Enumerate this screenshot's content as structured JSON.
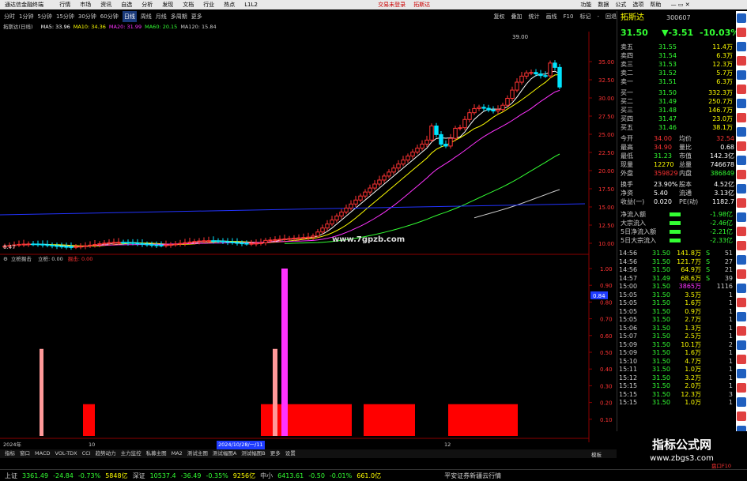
{
  "app": {
    "title": "通达信金融终端",
    "menu": [
      "行情",
      "市场",
      "资讯",
      "自选",
      "分析",
      "发现",
      "文档",
      "行业",
      "热点",
      "L1L2"
    ],
    "center_links": [
      "交易未登录",
      "拓斯达"
    ],
    "right_menu": [
      "功能",
      "数据",
      "公式",
      "选项",
      "帮助"
    ]
  },
  "periods": [
    "分时",
    "1分钟",
    "5分钟",
    "15分钟",
    "30分钟",
    "60分钟",
    "日线",
    "周线",
    "月线",
    "多周期",
    "更多"
  ],
  "selected_period": "日线",
  "toolbar_right": [
    "复权",
    "叠加",
    "统计",
    "画线",
    "F10",
    "标记",
    "-",
    "回退"
  ],
  "stock": {
    "name": "拓斯达",
    "code": "300607",
    "price": "31.50",
    "change": "▼-3.51",
    "pct": "-10.03%"
  },
  "main_legend": {
    "label": "拓斯达(日线)",
    "items": [
      {
        "text": "MA5: 33.96",
        "color": "#ffffff"
      },
      {
        "text": "MA10: 34.36",
        "color": "#ffff00"
      },
      {
        "text": "MA20: 31.99",
        "color": "#ff33ff"
      },
      {
        "text": "MA60: 20.15",
        "color": "#33ff33"
      },
      {
        "text": "MA120: 15.84",
        "color": "#cccccc"
      }
    ]
  },
  "price_labels": [
    "35.00",
    "32.50",
    "30.00",
    "27.50",
    "25.00",
    "22.50",
    "20.00",
    "17.50",
    "15.00",
    "12.50",
    "10.00"
  ],
  "max_label": "39.00",
  "min_label": "8.47",
  "watermark": "www.7gpzb.com",
  "sub_legend": {
    "name": "立桩掘击",
    "items": [
      {
        "text": "立桩: 0.00",
        "color": "#cccccc"
      },
      {
        "text": "掘击: 0.00",
        "color": "#ff3333"
      }
    ]
  },
  "sub_labels": [
    "1.00",
    "0.90",
    "0.80",
    "0.70",
    "0.60",
    "0.50",
    "0.40",
    "0.30",
    "0.20",
    "0.10"
  ],
  "sub_marker": "0.84",
  "date_axis": [
    "2024年",
    "10",
    "2024/10/28/一/11",
    "12"
  ],
  "sell": [
    {
      "label": "卖五",
      "price": "31.55",
      "vol": "11.4万"
    },
    {
      "label": "卖四",
      "price": "31.54",
      "vol": "6.3万"
    },
    {
      "label": "卖三",
      "price": "31.53",
      "vol": "12.3万"
    },
    {
      "label": "卖二",
      "price": "31.52",
      "vol": "5.7万"
    },
    {
      "label": "卖一",
      "price": "31.51",
      "vol": "6.3万"
    }
  ],
  "buy": [
    {
      "label": "买一",
      "price": "31.50",
      "vol": "332.3万"
    },
    {
      "label": "买二",
      "price": "31.49",
      "vol": "250.7万"
    },
    {
      "label": "买三",
      "price": "31.48",
      "vol": "146.7万"
    },
    {
      "label": "买四",
      "price": "31.47",
      "vol": "23.0万"
    },
    {
      "label": "买五",
      "price": "31.46",
      "vol": "38.1万"
    }
  ],
  "stats": [
    {
      "l1": "今开",
      "v1": "34.00",
      "l2": "均价",
      "v2": "32.54",
      "c1": "#ff3333",
      "c2": "#ff3333"
    },
    {
      "l1": "最高",
      "v1": "34.90",
      "l2": "量比",
      "v2": "0.68",
      "c1": "#ff3333",
      "c2": "#ffffff"
    },
    {
      "l1": "最低",
      "v1": "31.23",
      "l2": "市值",
      "v2": "142.3亿",
      "c1": "#33ff33",
      "c2": "#ffffff"
    },
    {
      "l1": "现量",
      "v1": "12270",
      "l2": "总量",
      "v2": "746678",
      "c1": "#ffff00",
      "c2": "#ffffff"
    },
    {
      "l1": "外盘",
      "v1": "359829",
      "l2": "内盘",
      "v2": "386849",
      "c1": "#ff3333",
      "c2": "#33ff33"
    }
  ],
  "stats2": [
    {
      "l1": "换手",
      "v1": "23.90%",
      "l2": "股本",
      "v2": "4.52亿"
    },
    {
      "l1": "净资",
      "v1": "5.40",
      "l2": "流通",
      "v2": "3.13亿"
    },
    {
      "l1": "收益(一)",
      "v1": "0.020",
      "l2": "PE(动)",
      "v2": "1182.7"
    }
  ],
  "flows": [
    {
      "label": "净流入额",
      "value": "-1.98亿"
    },
    {
      "label": "大宗流入",
      "value": "-2.46亿"
    },
    {
      "label": "5日净流入额",
      "value": "-2.21亿"
    },
    {
      "label": "5日大宗流入",
      "value": "-2.33亿"
    }
  ],
  "ticks": [
    {
      "t": "14:56",
      "p": "31.50",
      "v": "141.8万",
      "d": "S",
      "n": "51"
    },
    {
      "t": "14:56",
      "p": "31.50",
      "v": "121.7万",
      "d": "S",
      "n": "27"
    },
    {
      "t": "14:56",
      "p": "31.50",
      "v": "64.9万",
      "d": "S",
      "n": "21"
    },
    {
      "t": "14:57",
      "p": "31.49",
      "v": "68.6万",
      "d": "S",
      "n": "39"
    },
    {
      "t": "15:00",
      "p": "31.50",
      "v": "3865万",
      "d": "",
      "n": "1116"
    },
    {
      "t": "15:05",
      "p": "31.50",
      "v": "3.5万",
      "d": "",
      "n": "1"
    },
    {
      "t": "15:05",
      "p": "31.50",
      "v": "1.6万",
      "d": "",
      "n": "1"
    },
    {
      "t": "15:05",
      "p": "31.50",
      "v": "0.9万",
      "d": "",
      "n": "1"
    },
    {
      "t": "15:05",
      "p": "31.50",
      "v": "2.7万",
      "d": "",
      "n": "1"
    },
    {
      "t": "15:06",
      "p": "31.50",
      "v": "1.3万",
      "d": "",
      "n": "1"
    },
    {
      "t": "15:07",
      "p": "31.50",
      "v": "2.5万",
      "d": "",
      "n": "1"
    },
    {
      "t": "15:09",
      "p": "31.50",
      "v": "10.1万",
      "d": "",
      "n": "2"
    },
    {
      "t": "15:09",
      "p": "31.50",
      "v": "1.6万",
      "d": "",
      "n": "1"
    },
    {
      "t": "15:10",
      "p": "31.50",
      "v": "4.7万",
      "d": "",
      "n": "1"
    },
    {
      "t": "15:11",
      "p": "31.50",
      "v": "1.0万",
      "d": "",
      "n": "1"
    },
    {
      "t": "15:12",
      "p": "31.50",
      "v": "3.2万",
      "d": "",
      "n": "1"
    },
    {
      "t": "15:15",
      "p": "31.50",
      "v": "2.0万",
      "d": "",
      "n": "1"
    },
    {
      "t": "15:15",
      "p": "31.50",
      "v": "12.3万",
      "d": "",
      "n": "3"
    },
    {
      "t": "15:15",
      "p": "31.50",
      "v": "1.0万",
      "d": "",
      "n": "1"
    }
  ],
  "bottom_tabs": [
    "指标",
    "窗口",
    "MACD",
    "VOL-TDX",
    "CCI",
    "趋势动力",
    "主力监控",
    "私募主图",
    "MA2",
    "测试主图",
    "测试幅图A",
    "测试幅图B",
    "更多",
    "设置"
  ],
  "bottom_right": "模板",
  "status": [
    {
      "text": "上证",
      "color": "#cccccc"
    },
    {
      "text": "3361.49",
      "color": "#33ff33"
    },
    {
      "text": "-24.84",
      "color": "#33ff33"
    },
    {
      "text": "-0.73%",
      "color": "#33ff33"
    },
    {
      "text": "5848亿",
      "color": "#ffff00"
    },
    {
      "text": "深证",
      "color": "#cccccc"
    },
    {
      "text": "10537.4",
      "color": "#33ff33"
    },
    {
      "text": "-36.49",
      "color": "#33ff33"
    },
    {
      "text": "-0.35%",
      "color": "#33ff33"
    },
    {
      "text": "9256亿",
      "color": "#ffff00"
    },
    {
      "text": "中小",
      "color": "#cccccc"
    },
    {
      "text": "6413.61",
      "color": "#33ff33"
    },
    {
      "text": "-0.50",
      "color": "#33ff33"
    },
    {
      "text": "-0.01%",
      "color": "#33ff33"
    },
    {
      "text": "661.0亿",
      "color": "#ffff00"
    }
  ],
  "status_right": "平安证券新疆云行情",
  "wm_title": "指标公式网",
  "wm_url": "www.zbgs3.com",
  "wm_footer": "盘口F10"
}
